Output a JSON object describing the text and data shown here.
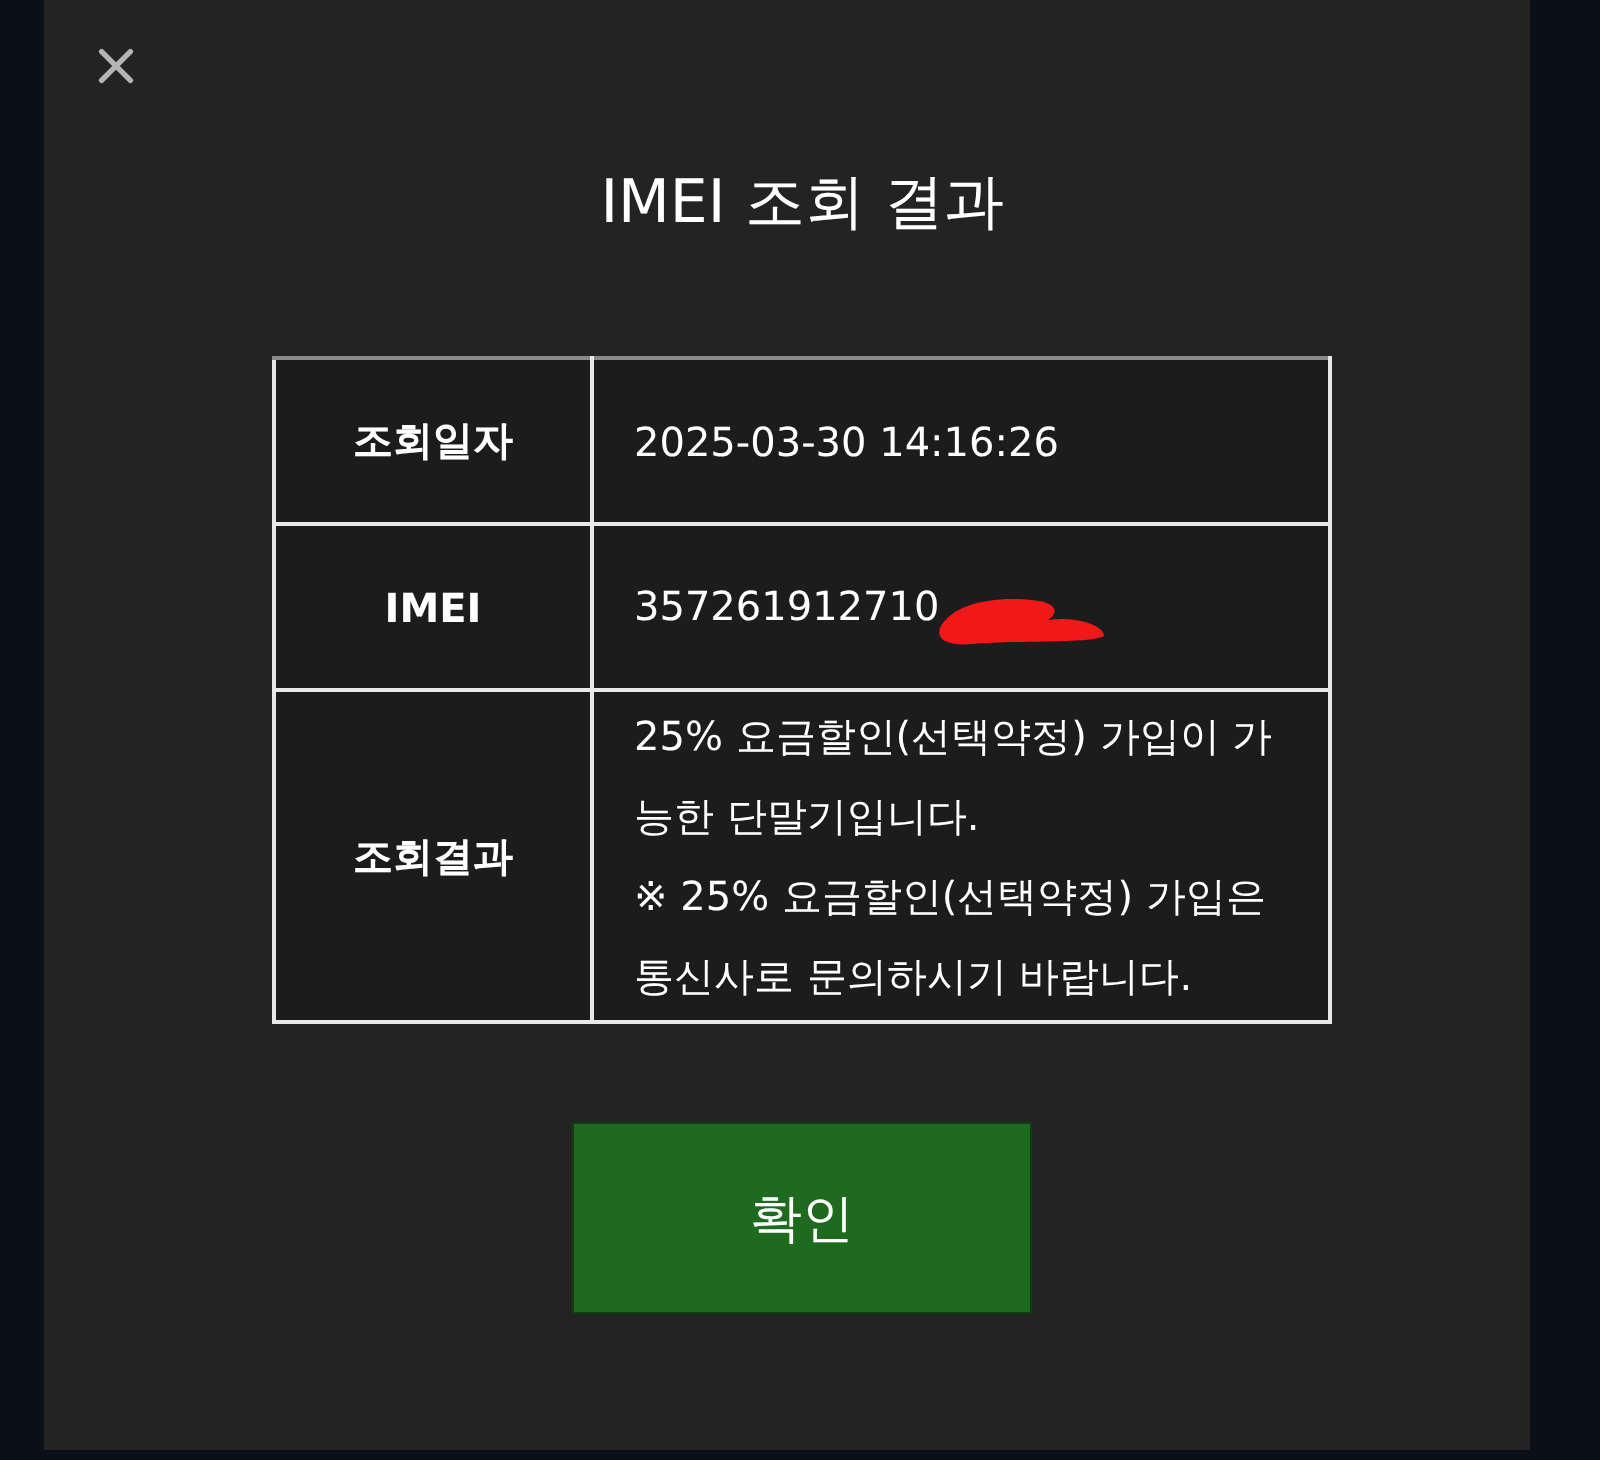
{
  "window": {
    "title": "IMEI 조회 결과"
  },
  "table": {
    "rows": [
      {
        "label": "조회일자",
        "lines": [
          "2025-03-30 14:16:26"
        ],
        "redacted": false
      },
      {
        "label": "IMEI",
        "lines": [
          "357261912710"
        ],
        "redacted": true
      },
      {
        "label": "조회결과",
        "lines": [
          "25% 요금할인(선택약정) 가입이 가능한 단말기입니다.",
          "※ 25% 요금할인(선택약정) 가입은 통신사로 문의하시기 바랍니다."
        ],
        "redacted": false
      }
    ]
  },
  "button": {
    "label": "확인"
  }
}
